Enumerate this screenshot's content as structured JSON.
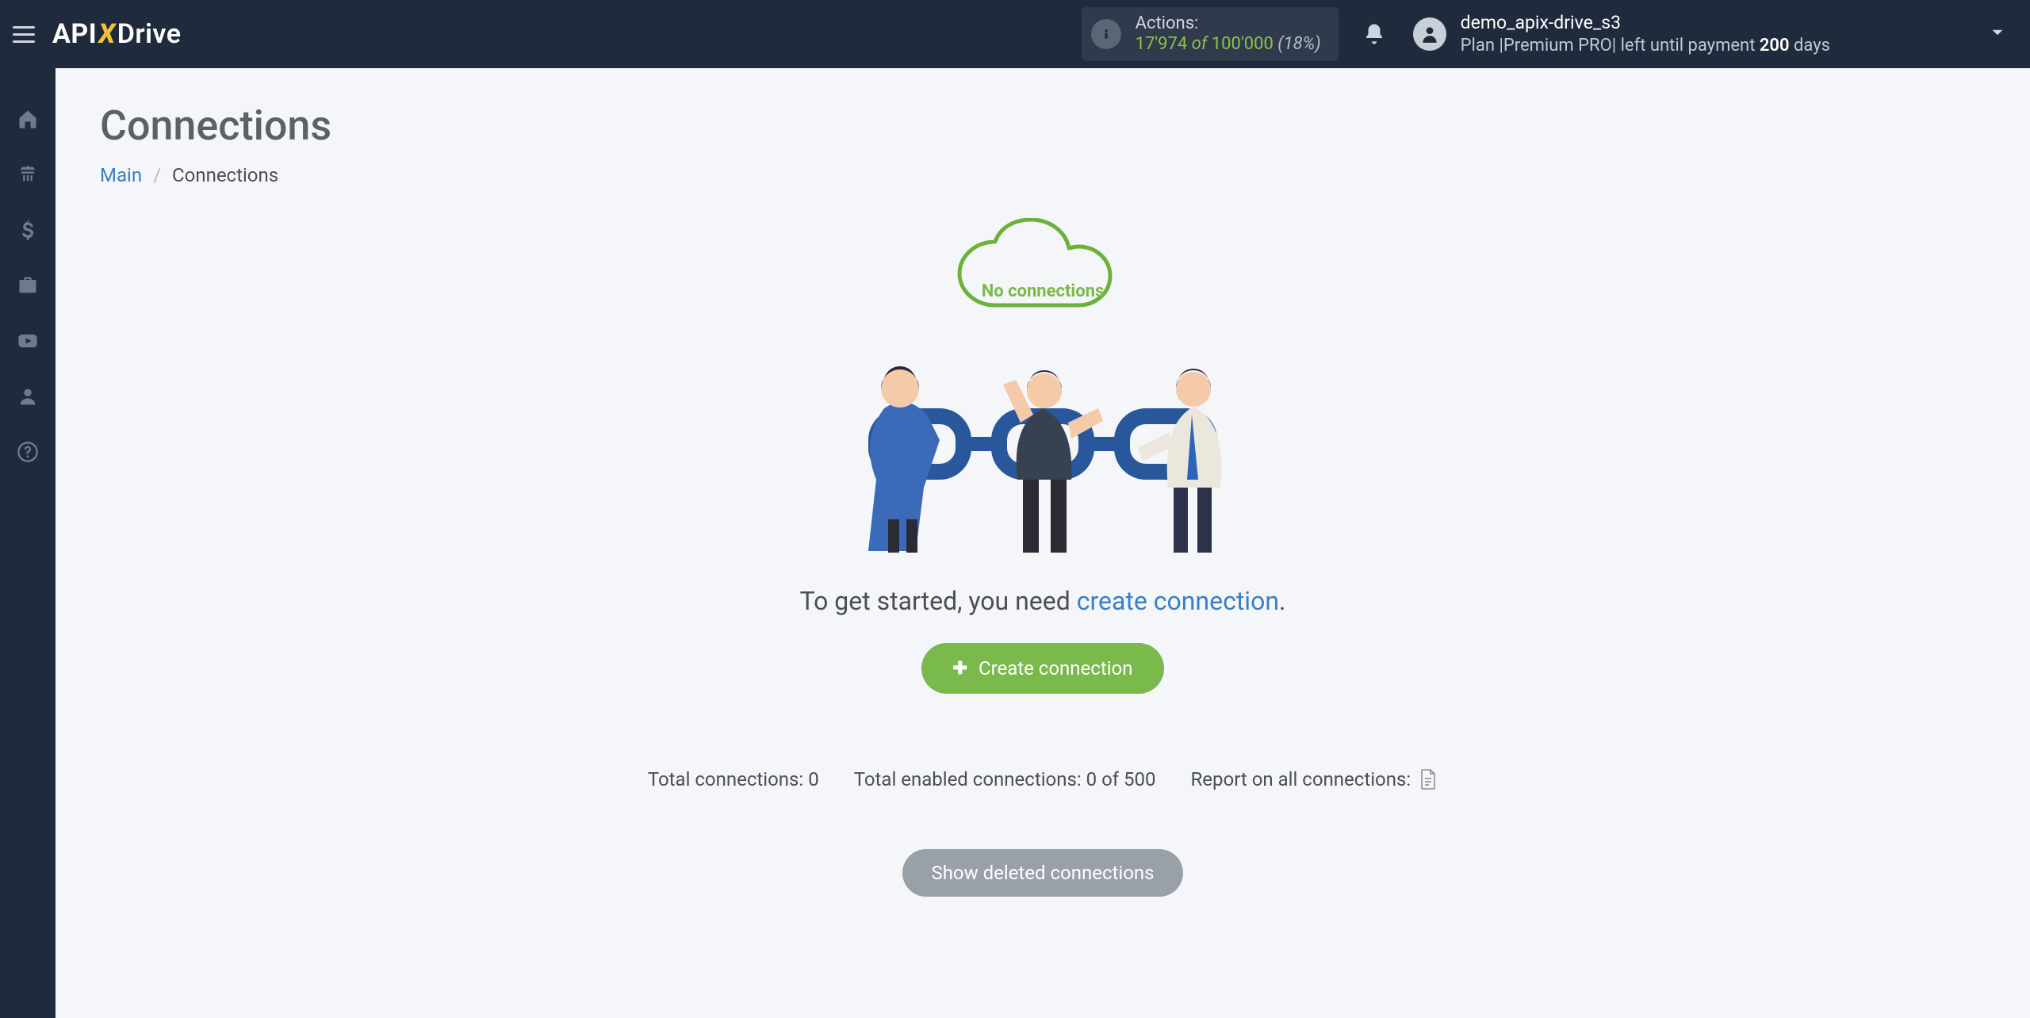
{
  "header": {
    "logo": {
      "part1": "API",
      "part2": "X",
      "part3": "Drive"
    },
    "actions": {
      "label": "Actions:",
      "used": "17'974",
      "of_word": "of",
      "total": "100'000",
      "pct": "(18%)"
    },
    "user": {
      "name": "demo_apix-drive_s3",
      "plan_prefix": "Plan |",
      "plan_name": "Premium PRO",
      "plan_mid": "| left until payment ",
      "days_number": "200",
      "days_word": " days"
    }
  },
  "sidebar": {
    "items": [
      {
        "name": "home"
      },
      {
        "name": "connections"
      },
      {
        "name": "billing"
      },
      {
        "name": "briefcase"
      },
      {
        "name": "video"
      },
      {
        "name": "account"
      },
      {
        "name": "help"
      }
    ]
  },
  "page": {
    "title": "Connections",
    "breadcrumb": {
      "home": "Main",
      "current": "Connections"
    },
    "empty": {
      "cloud_text": "No connections",
      "get_started_prefix": "To get started, you need ",
      "get_started_link": "create connection",
      "get_started_suffix": ".",
      "create_btn": "Create connection"
    },
    "stats": {
      "total_label": "Total connections: ",
      "total_value": "0",
      "enabled_label": "Total enabled connections: ",
      "enabled_value": "0 of 500",
      "report_label": "Report on all connections:"
    },
    "show_deleted": "Show deleted connections"
  }
}
